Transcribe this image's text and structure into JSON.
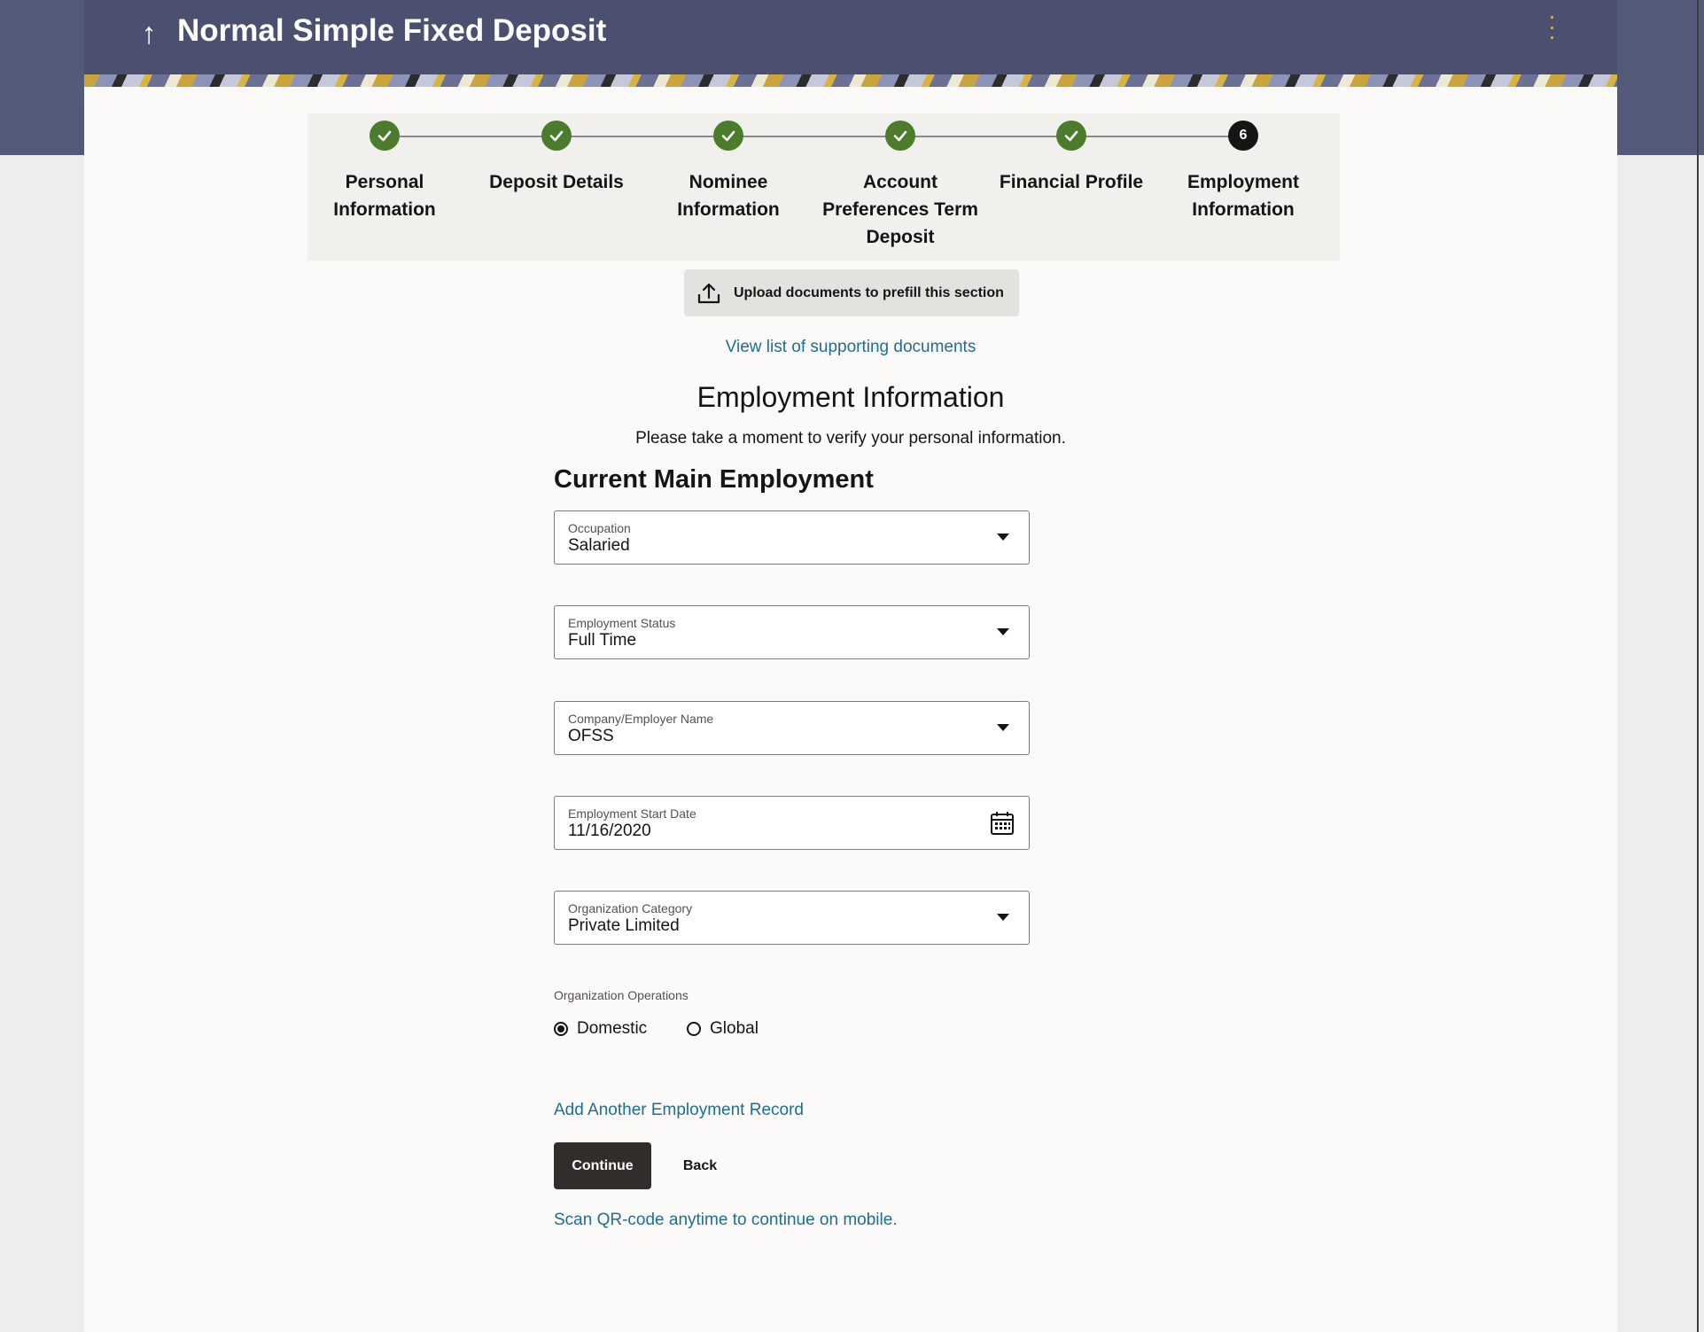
{
  "header": {
    "title": "Normal Simple Fixed Deposit",
    "back_icon": "arrow-up-icon",
    "menu_icon": "kebab-menu-icon"
  },
  "stepper": {
    "current_step": 6,
    "steps": [
      {
        "label": "Personal Information",
        "status": "completed"
      },
      {
        "label": "Deposit Details",
        "status": "completed"
      },
      {
        "label": "Nominee Information",
        "status": "completed"
      },
      {
        "label": "Account Preferences Term Deposit",
        "status": "completed"
      },
      {
        "label": "Financial Profile",
        "status": "completed"
      },
      {
        "label": "Employment Information",
        "status": "current",
        "number": "6"
      }
    ]
  },
  "upload": {
    "label": "Upload documents to prefill this section",
    "icon": "upload-icon"
  },
  "supporting_docs_link": "View list of supporting documents",
  "section": {
    "title": "Employment Information",
    "description": "Please take a moment to verify your personal information.",
    "subheading": "Current Main Employment"
  },
  "form": {
    "occupation": {
      "label": "Occupation",
      "value": "Salaried"
    },
    "employment_status": {
      "label": "Employment Status",
      "value": "Full Time"
    },
    "employer_name": {
      "label": "Company/Employer Name",
      "value": "OFSS"
    },
    "start_date": {
      "label": "Employment Start Date",
      "value": "11/16/2020"
    },
    "organization_category": {
      "label": "Organization Category",
      "value": "Private Limited"
    },
    "organization_operations": {
      "label": "Organization Operations",
      "options": [
        "Domestic",
        "Global"
      ],
      "selected": "Domestic"
    }
  },
  "actions": {
    "add_record": "Add Another Employment Record",
    "continue": "Continue",
    "back": "Back",
    "scan_qr": "Scan QR-code anytime to continue on mobile."
  },
  "colors": {
    "header_bg": "#4b5070",
    "step_done": "#4a7c2c",
    "link": "#1e6f8f",
    "primary_button": "#312d2a"
  }
}
